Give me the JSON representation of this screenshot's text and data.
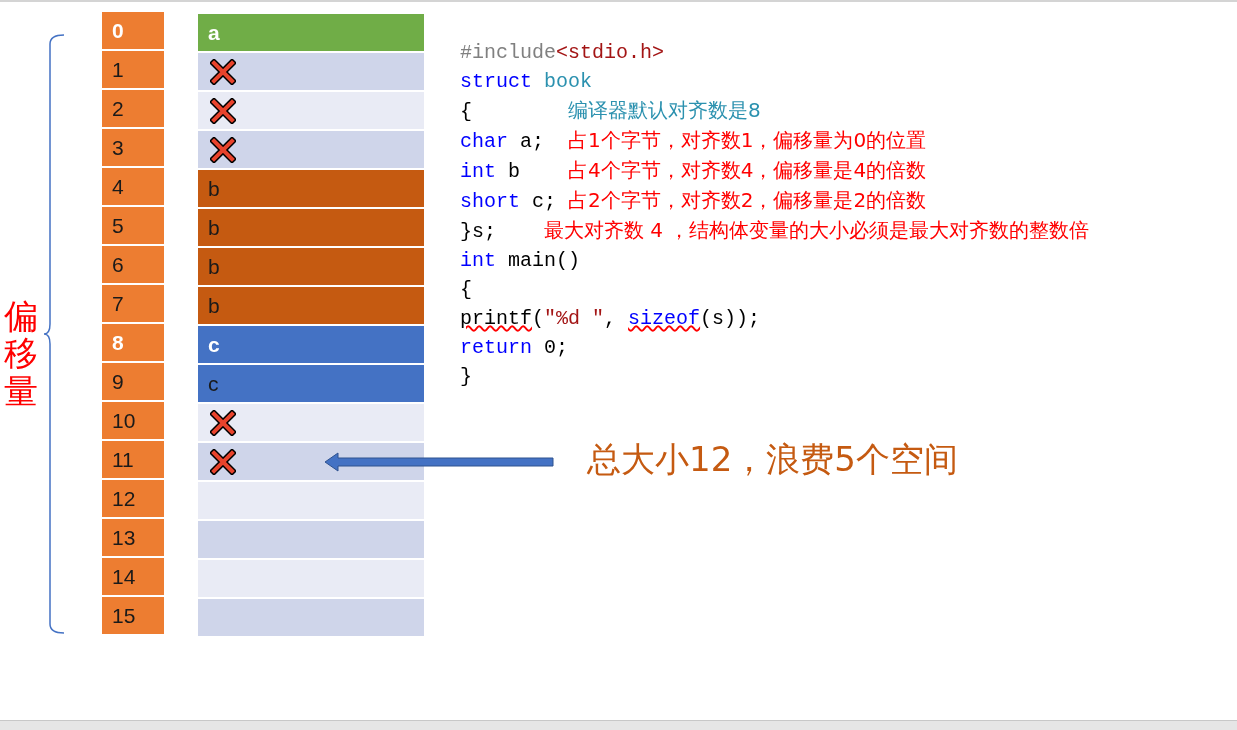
{
  "axis_label": "偏移量",
  "offsets": [
    {
      "text": "0",
      "bold": true
    },
    {
      "text": "1",
      "bold": false
    },
    {
      "text": "2",
      "bold": false
    },
    {
      "text": "3",
      "bold": false
    },
    {
      "text": "4",
      "bold": false
    },
    {
      "text": "5",
      "bold": false
    },
    {
      "text": "6",
      "bold": false
    },
    {
      "text": "7",
      "bold": false
    },
    {
      "text": "8",
      "bold": true
    },
    {
      "text": "9",
      "bold": false
    },
    {
      "text": "10",
      "bold": false
    },
    {
      "text": "11",
      "bold": false
    },
    {
      "text": "12",
      "bold": false
    },
    {
      "text": "13",
      "bold": false
    },
    {
      "text": "14",
      "bold": false
    },
    {
      "text": "15",
      "bold": false
    }
  ],
  "cells": [
    {
      "kind": "member",
      "text": "a",
      "bold": true,
      "color": "#70ad47"
    },
    {
      "kind": "padding"
    },
    {
      "kind": "padding"
    },
    {
      "kind": "padding"
    },
    {
      "kind": "member",
      "text": "b",
      "bold": false,
      "color": "#c55a11"
    },
    {
      "kind": "member",
      "text": "b",
      "bold": false,
      "color": "#c55a11"
    },
    {
      "kind": "member",
      "text": "b",
      "bold": false,
      "color": "#c55a11"
    },
    {
      "kind": "member",
      "text": "b",
      "bold": false,
      "color": "#c55a11"
    },
    {
      "kind": "member",
      "text": "c",
      "bold": true,
      "color": "#4472c4"
    },
    {
      "kind": "member",
      "text": "c",
      "bold": false,
      "color": "#4472c4"
    },
    {
      "kind": "padding"
    },
    {
      "kind": "padding"
    },
    {
      "kind": "empty"
    },
    {
      "kind": "empty"
    },
    {
      "kind": "empty"
    },
    {
      "kind": "empty"
    }
  ],
  "code_lines": [
    [
      {
        "text": "#include",
        "kind": "directive"
      },
      {
        "text": "<stdio.h>",
        "kind": "header"
      }
    ],
    [
      {
        "text": "struct ",
        "kind": "keyword"
      },
      {
        "text": "book",
        "kind": "ident"
      }
    ],
    [
      {
        "text": "{        ",
        "kind": "plain"
      },
      {
        "text": "编译器默认对齐数是8",
        "kind": "note-teal"
      }
    ],
    [
      {
        "text": "char ",
        "kind": "keyword"
      },
      {
        "text": "a;  ",
        "kind": "plain"
      },
      {
        "text": "占1个字节，对齐数1，偏移量为0的位置",
        "kind": "note"
      }
    ],
    [
      {
        "text": "int ",
        "kind": "keyword"
      },
      {
        "text": "b    ",
        "kind": "plain"
      },
      {
        "text": "占4个字节，对齐数4，偏移量是4的倍数",
        "kind": "note"
      }
    ],
    [
      {
        "text": "short ",
        "kind": "keyword"
      },
      {
        "text": "c; ",
        "kind": "plain"
      },
      {
        "text": "占2个字节，对齐数2，偏移量是2的倍数",
        "kind": "note"
      }
    ],
    [
      {
        "text": "}s;    ",
        "kind": "plain"
      },
      {
        "text": "最大对齐数 4 ，结构体变量的大小必须是最大对齐数的整数倍",
        "kind": "note"
      }
    ],
    [
      {
        "text": "int ",
        "kind": "keyword"
      },
      {
        "text": "main()",
        "kind": "plain"
      }
    ],
    [
      {
        "text": "{",
        "kind": "plain"
      }
    ],
    [
      {
        "text": "printf",
        "kind": "flagged"
      },
      {
        "text": "(",
        "kind": "plain"
      },
      {
        "text": "\"%d \"",
        "kind": "string"
      },
      {
        "text": ", ",
        "kind": "plain"
      },
      {
        "text": "sizeof",
        "kind": "flagged-keyword"
      },
      {
        "text": "(s));",
        "kind": "plain"
      }
    ],
    [
      {
        "text": "return ",
        "kind": "keyword"
      },
      {
        "text": "0;",
        "kind": "plain"
      }
    ],
    [
      {
        "text": "}",
        "kind": "plain"
      }
    ]
  ],
  "annotation": "总大小12，浪费5个空间"
}
